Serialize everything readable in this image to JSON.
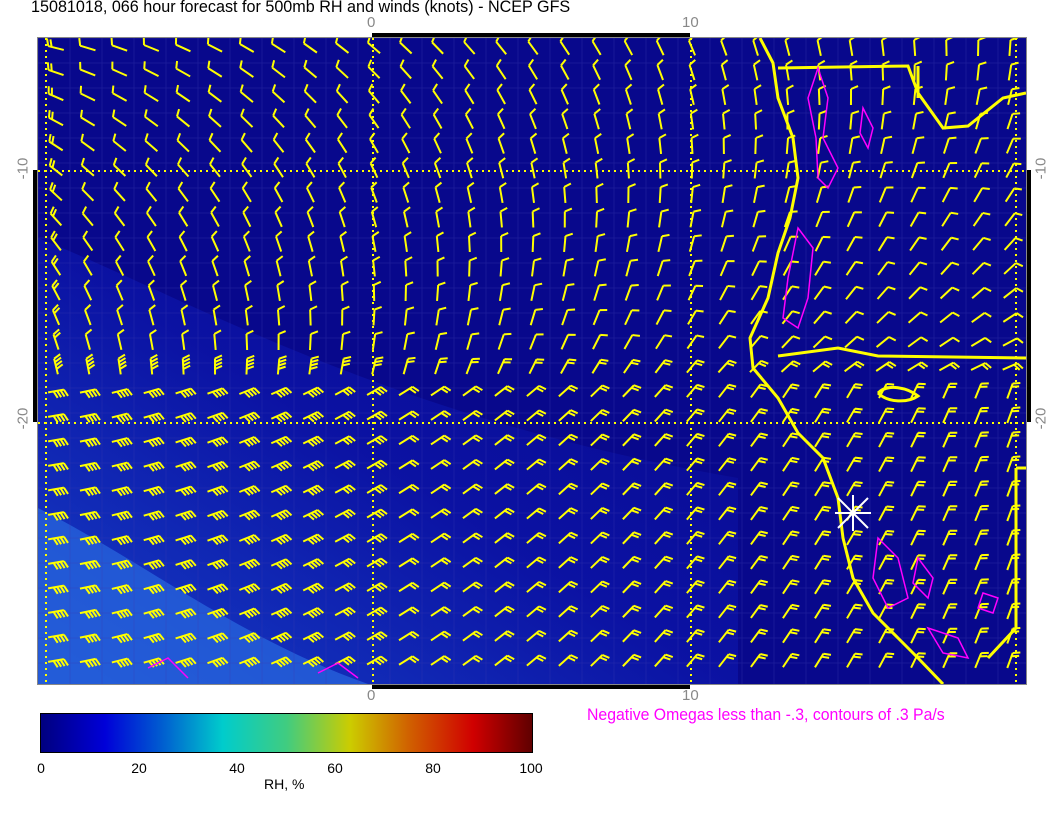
{
  "title": "15081018, 066 hour forecast for 500mb RH and winds (knots) - NCEP GFS",
  "axes": {
    "top_ticks": [
      "0",
      "10"
    ],
    "bottom_ticks": [
      "0",
      "10"
    ],
    "left_ticks": [
      "-10",
      "-20"
    ],
    "right_ticks": [
      "-10",
      "-20"
    ]
  },
  "omega_note": "Negative Omegas less than -.3, contours of .3 Pa/s",
  "colorbar": {
    "ticks": [
      "0",
      "20",
      "40",
      "60",
      "80",
      "100"
    ],
    "label": "RH, %",
    "range": [
      0,
      100
    ]
  },
  "colors": {
    "background_rh": "#08088c",
    "wind_barbs": "#ffff00",
    "coastline": "#ffff00",
    "omega_contours": "#ff00ff"
  }
}
